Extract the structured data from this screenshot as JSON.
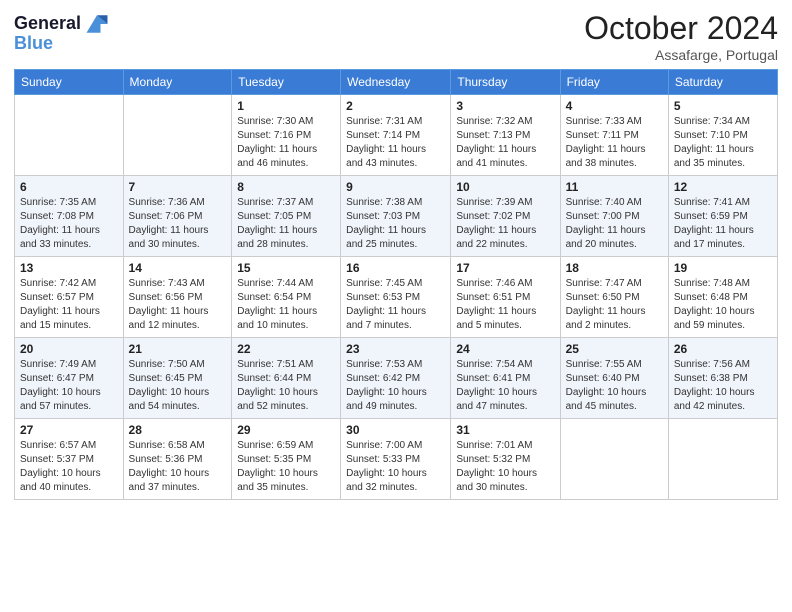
{
  "logo": {
    "line1": "General",
    "line2": "Blue"
  },
  "title": "October 2024",
  "location": "Assafarge, Portugal",
  "days_header": [
    "Sunday",
    "Monday",
    "Tuesday",
    "Wednesday",
    "Thursday",
    "Friday",
    "Saturday"
  ],
  "weeks": [
    [
      {
        "day": "",
        "text": ""
      },
      {
        "day": "",
        "text": ""
      },
      {
        "day": "1",
        "text": "Sunrise: 7:30 AM\nSunset: 7:16 PM\nDaylight: 11 hours and 46 minutes."
      },
      {
        "day": "2",
        "text": "Sunrise: 7:31 AM\nSunset: 7:14 PM\nDaylight: 11 hours and 43 minutes."
      },
      {
        "day": "3",
        "text": "Sunrise: 7:32 AM\nSunset: 7:13 PM\nDaylight: 11 hours and 41 minutes."
      },
      {
        "day": "4",
        "text": "Sunrise: 7:33 AM\nSunset: 7:11 PM\nDaylight: 11 hours and 38 minutes."
      },
      {
        "day": "5",
        "text": "Sunrise: 7:34 AM\nSunset: 7:10 PM\nDaylight: 11 hours and 35 minutes."
      }
    ],
    [
      {
        "day": "6",
        "text": "Sunrise: 7:35 AM\nSunset: 7:08 PM\nDaylight: 11 hours and 33 minutes."
      },
      {
        "day": "7",
        "text": "Sunrise: 7:36 AM\nSunset: 7:06 PM\nDaylight: 11 hours and 30 minutes."
      },
      {
        "day": "8",
        "text": "Sunrise: 7:37 AM\nSunset: 7:05 PM\nDaylight: 11 hours and 28 minutes."
      },
      {
        "day": "9",
        "text": "Sunrise: 7:38 AM\nSunset: 7:03 PM\nDaylight: 11 hours and 25 minutes."
      },
      {
        "day": "10",
        "text": "Sunrise: 7:39 AM\nSunset: 7:02 PM\nDaylight: 11 hours and 22 minutes."
      },
      {
        "day": "11",
        "text": "Sunrise: 7:40 AM\nSunset: 7:00 PM\nDaylight: 11 hours and 20 minutes."
      },
      {
        "day": "12",
        "text": "Sunrise: 7:41 AM\nSunset: 6:59 PM\nDaylight: 11 hours and 17 minutes."
      }
    ],
    [
      {
        "day": "13",
        "text": "Sunrise: 7:42 AM\nSunset: 6:57 PM\nDaylight: 11 hours and 15 minutes."
      },
      {
        "day": "14",
        "text": "Sunrise: 7:43 AM\nSunset: 6:56 PM\nDaylight: 11 hours and 12 minutes."
      },
      {
        "day": "15",
        "text": "Sunrise: 7:44 AM\nSunset: 6:54 PM\nDaylight: 11 hours and 10 minutes."
      },
      {
        "day": "16",
        "text": "Sunrise: 7:45 AM\nSunset: 6:53 PM\nDaylight: 11 hours and 7 minutes."
      },
      {
        "day": "17",
        "text": "Sunrise: 7:46 AM\nSunset: 6:51 PM\nDaylight: 11 hours and 5 minutes."
      },
      {
        "day": "18",
        "text": "Sunrise: 7:47 AM\nSunset: 6:50 PM\nDaylight: 11 hours and 2 minutes."
      },
      {
        "day": "19",
        "text": "Sunrise: 7:48 AM\nSunset: 6:48 PM\nDaylight: 10 hours and 59 minutes."
      }
    ],
    [
      {
        "day": "20",
        "text": "Sunrise: 7:49 AM\nSunset: 6:47 PM\nDaylight: 10 hours and 57 minutes."
      },
      {
        "day": "21",
        "text": "Sunrise: 7:50 AM\nSunset: 6:45 PM\nDaylight: 10 hours and 54 minutes."
      },
      {
        "day": "22",
        "text": "Sunrise: 7:51 AM\nSunset: 6:44 PM\nDaylight: 10 hours and 52 minutes."
      },
      {
        "day": "23",
        "text": "Sunrise: 7:53 AM\nSunset: 6:42 PM\nDaylight: 10 hours and 49 minutes."
      },
      {
        "day": "24",
        "text": "Sunrise: 7:54 AM\nSunset: 6:41 PM\nDaylight: 10 hours and 47 minutes."
      },
      {
        "day": "25",
        "text": "Sunrise: 7:55 AM\nSunset: 6:40 PM\nDaylight: 10 hours and 45 minutes."
      },
      {
        "day": "26",
        "text": "Sunrise: 7:56 AM\nSunset: 6:38 PM\nDaylight: 10 hours and 42 minutes."
      }
    ],
    [
      {
        "day": "27",
        "text": "Sunrise: 6:57 AM\nSunset: 5:37 PM\nDaylight: 10 hours and 40 minutes."
      },
      {
        "day": "28",
        "text": "Sunrise: 6:58 AM\nSunset: 5:36 PM\nDaylight: 10 hours and 37 minutes."
      },
      {
        "day": "29",
        "text": "Sunrise: 6:59 AM\nSunset: 5:35 PM\nDaylight: 10 hours and 35 minutes."
      },
      {
        "day": "30",
        "text": "Sunrise: 7:00 AM\nSunset: 5:33 PM\nDaylight: 10 hours and 32 minutes."
      },
      {
        "day": "31",
        "text": "Sunrise: 7:01 AM\nSunset: 5:32 PM\nDaylight: 10 hours and 30 minutes."
      },
      {
        "day": "",
        "text": ""
      },
      {
        "day": "",
        "text": ""
      }
    ]
  ]
}
